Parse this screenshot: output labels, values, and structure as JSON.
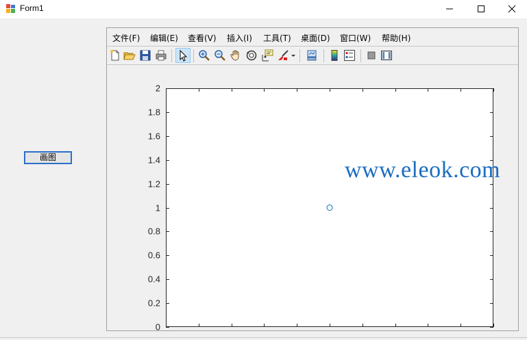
{
  "window": {
    "title": "Form1"
  },
  "form": {
    "plot_button_label": "画图"
  },
  "menu": {
    "items": [
      {
        "label": "文件(F)"
      },
      {
        "label": "编辑(E)"
      },
      {
        "label": "查看(V)"
      },
      {
        "label": "插入(I)"
      },
      {
        "label": "工具(T)"
      },
      {
        "label": "桌面(D)"
      },
      {
        "label": "窗口(W)"
      },
      {
        "label": "帮助(H)"
      }
    ]
  },
  "toolbar": {
    "icons": [
      "new-figure-icon",
      "open-file-icon",
      "save-icon",
      "print-icon",
      "select-arrow-icon",
      "zoom-in-icon",
      "zoom-out-icon",
      "pan-hand-icon",
      "rotate-3d-icon",
      "data-cursor-icon",
      "brush-icon",
      "brush-dropdown-icon",
      "link-plot-icon",
      "colorbar-icon",
      "legend-icon",
      "hide-plot-tools-icon",
      "show-plot-tools-icon"
    ]
  },
  "chart_data": {
    "type": "scatter",
    "series": [
      {
        "x": [
          5
        ],
        "y": [
          1
        ],
        "marker": "circle",
        "color": "#0072bd"
      }
    ],
    "xlim": [
      0,
      10
    ],
    "ylim": [
      0,
      2
    ],
    "yticks": [
      0,
      0.2,
      0.4,
      0.6,
      0.8,
      1,
      1.2,
      1.4,
      1.6,
      1.8,
      2
    ],
    "ytick_labels": [
      "0",
      "0.2",
      "0.4",
      "0.6",
      "0.8",
      "1",
      "1.2",
      "1.4",
      "1.6",
      "1.8",
      "2"
    ],
    "xticks": [
      0,
      1,
      2,
      3,
      4,
      5,
      6,
      7,
      8,
      9,
      10
    ],
    "grid": false
  },
  "watermark": {
    "text": "www.eleok.com"
  }
}
